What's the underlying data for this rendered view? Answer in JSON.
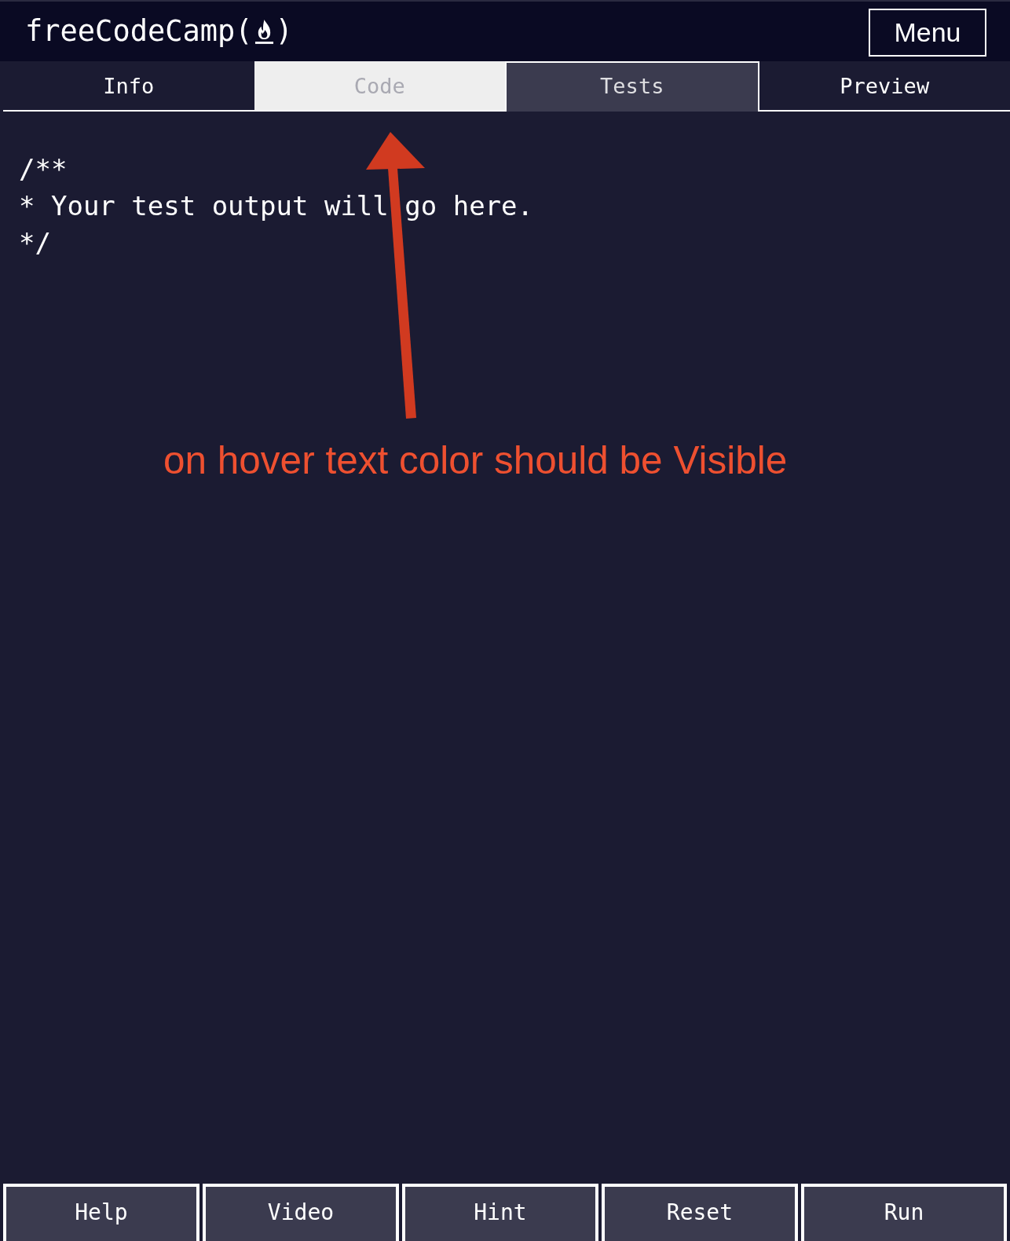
{
  "header": {
    "logo_text": "freeCodeCamp(",
    "logo_close": ")",
    "menu_button": "Menu"
  },
  "tabs": [
    {
      "label": "Info",
      "selected": false,
      "hovered": false
    },
    {
      "label": "Code",
      "selected": false,
      "hovered": true
    },
    {
      "label": "Tests",
      "selected": true,
      "hovered": false
    },
    {
      "label": "Preview",
      "selected": false,
      "hovered": false
    }
  ],
  "output": {
    "lines": [
      "/**",
      "* Your test output will go here.",
      "*/"
    ]
  },
  "annotation": {
    "text": "on hover text color should be Visible"
  },
  "buttons": [
    "Help",
    "Video",
    "Hint",
    "Reset",
    "Run"
  ]
}
